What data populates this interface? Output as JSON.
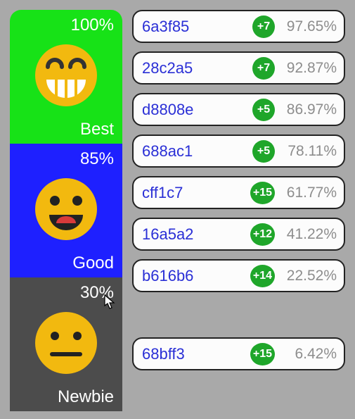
{
  "tiers": [
    {
      "pct": "100%",
      "label": "Best",
      "color": "#17e217",
      "face": "grin"
    },
    {
      "pct": "85%",
      "label": "Good",
      "color": "#1e20ff",
      "face": "smile"
    },
    {
      "pct": "30%",
      "label": "Newbie",
      "color": "#4c4c4c",
      "face": "neutral"
    }
  ],
  "rows": [
    {
      "id": "6a3f85",
      "delta": "+7",
      "pct": "97.65%"
    },
    {
      "id": "28c2a5",
      "delta": "+7",
      "pct": "92.87%"
    },
    {
      "id": "d8808e",
      "delta": "+5",
      "pct": "86.97%"
    },
    {
      "id": "688ac1",
      "delta": "+5",
      "pct": "78.11%"
    },
    {
      "id": "cff1c7",
      "delta": "+15",
      "pct": "61.77%"
    },
    {
      "id": "16a5a2",
      "delta": "+12",
      "pct": "41.22%"
    },
    {
      "id": "b616b6",
      "delta": "+14",
      "pct": "22.52%"
    },
    {
      "id": "68bff3",
      "delta": "+15",
      "pct": "6.42%"
    }
  ],
  "gap_after_index": 6
}
